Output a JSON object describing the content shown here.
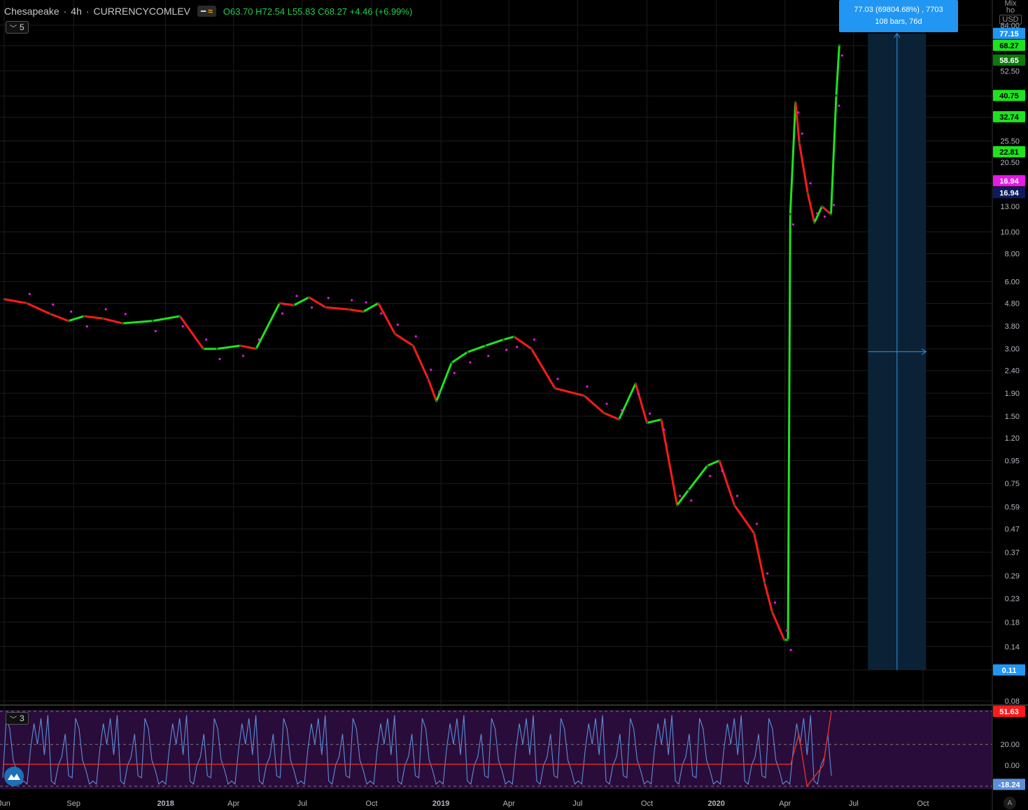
{
  "header": {
    "symbol": "Chesapeake",
    "sep1": "·",
    "interval": "4h",
    "sep2": "·",
    "exchange": "CURRENCYCOMLEV",
    "ohlc": {
      "open_label": "O",
      "open": "63.70",
      "high_label": "H",
      "high": "72.54",
      "low_label": "L",
      "low": "55.83",
      "close_label": "C",
      "close": "68.27",
      "change": "+4.46 (+6.99%)"
    }
  },
  "main_pane_collapse": {
    "label": "5",
    "icon": "chevron-down-icon"
  },
  "indicator_pane_collapse": {
    "label": "3",
    "icon": "chevron-down-icon"
  },
  "measure_tooltip": {
    "line1": "77.03 (69804.68%) , 7703",
    "line2": "108 bars, 76d"
  },
  "currency": {
    "top": "Mix ho",
    "code": "USD"
  },
  "auto_button": "A",
  "colors": {
    "background": "#000000",
    "grid": "#1c1c1c",
    "up": "#1ee31e",
    "down": "#ff1a1a",
    "sar": "#e619e6",
    "oscillator": "#5b8fd9",
    "oscillator_signal": "#e0302a",
    "indicator_bg": "#2a0c3a",
    "measure": "#2196f3",
    "measure_band": "#0b2236"
  },
  "chart_data": [
    {
      "type": "line",
      "title": "",
      "scale": "log",
      "x": [
        "2017-06-01",
        "2017-07-01",
        "2017-08-01",
        "2017-08-25",
        "2017-09-15",
        "2017-10-10",
        "2017-11-05",
        "2017-12-15",
        "2018-01-20",
        "2018-02-20",
        "2018-03-10",
        "2018-04-10",
        "2018-05-01",
        "2018-06-01",
        "2018-06-20",
        "2018-07-10",
        "2018-08-01",
        "2018-09-01",
        "2018-09-20",
        "2018-10-10",
        "2018-11-01",
        "2018-11-25",
        "2018-12-15",
        "2018-12-26",
        "2019-01-15",
        "2019-02-05",
        "2019-03-01",
        "2019-03-25",
        "2019-04-08",
        "2019-05-01",
        "2019-06-01",
        "2019-07-10",
        "2019-08-05",
        "2019-08-25",
        "2019-09-16",
        "2019-10-01",
        "2019-10-20",
        "2019-11-10",
        "2019-11-25",
        "2019-12-20",
        "2020-01-05",
        "2020-01-25",
        "2020-02-20",
        "2020-03-05",
        "2020-03-15",
        "2020-03-31",
        "2020-04-05",
        "2020-04-08",
        "2020-04-15",
        "2020-04-20",
        "2020-05-01",
        "2020-05-10",
        "2020-05-20",
        "2020-06-01",
        "2020-06-08",
        "2020-06-12"
      ],
      "series": [
        {
          "values": [
            5.0,
            4.8,
            4.3,
            4.0,
            4.2,
            4.1,
            3.9,
            4.0,
            4.2,
            3.0,
            3.0,
            3.1,
            3.0,
            4.8,
            4.7,
            5.1,
            4.6,
            4.5,
            4.4,
            4.8,
            3.5,
            3.1,
            2.2,
            1.75,
            2.6,
            2.9,
            3.1,
            3.3,
            3.4,
            3.0,
            2.0,
            1.85,
            1.55,
            1.45,
            2.1,
            1.4,
            1.45,
            0.6,
            0.7,
            0.9,
            0.95,
            0.6,
            0.45,
            0.27,
            0.2,
            0.15,
            0.15,
            12.0,
            38.0,
            25.0,
            15.0,
            11.0,
            13.0,
            12.0,
            40.75,
            68.27
          ]
        }
      ],
      "y_ticks": [
        "84.00",
        "68.00",
        "52.50",
        "40.50",
        "32.50",
        "25.50",
        "20.50",
        "16.50",
        "13.00",
        "10.00",
        "8.00",
        "6.00",
        "4.80",
        "3.80",
        "3.00",
        "2.40",
        "1.90",
        "1.50",
        "1.20",
        "0.95",
        "0.75",
        "0.59",
        "0.47",
        "0.37",
        "0.29",
        "0.23",
        "0.18",
        "0.14",
        "0.11",
        "0.08"
      ],
      "y_tick_values": [
        84,
        68,
        52.5,
        40.5,
        32.5,
        25.5,
        20.5,
        16.5,
        13,
        10,
        8,
        6,
        4.8,
        3.8,
        3,
        2.4,
        1.9,
        1.5,
        1.2,
        0.95,
        0.75,
        0.59,
        0.47,
        0.37,
        0.29,
        0.23,
        0.18,
        0.14,
        0.11,
        0.08
      ],
      "price_badges": [
        {
          "value": 77.15,
          "label": "77.15",
          "color": "#2196f3"
        },
        {
          "value": 68.27,
          "label": "68.27",
          "color": "#1ee31e"
        },
        {
          "value": 58.65,
          "label": "58.65",
          "color": "#0b7a0b"
        },
        {
          "value": 40.75,
          "label": "40.75",
          "color": "#1ee31e"
        },
        {
          "value": 32.74,
          "label": "32.74",
          "color": "#1ee31e"
        },
        {
          "value": 22.81,
          "label": "22.81",
          "color": "#1ee31e"
        },
        {
          "value": 16.94,
          "label": "16.94",
          "color": "#e619e6"
        },
        {
          "value": 16.94,
          "label": "16.94",
          "color": "#0d1b5e"
        },
        {
          "value": 0.11,
          "label": "0.11",
          "color": "#2196f3"
        }
      ],
      "x_ticks": [
        "Jun",
        "Sep",
        "2018",
        "Apr",
        "Jul",
        "Oct",
        "2019",
        "Apr",
        "Jul",
        "Oct",
        "2020",
        "Apr",
        "Jul",
        "Oct"
      ],
      "x_tick_dates": [
        "2017-06-01",
        "2017-09-01",
        "2018-01-01",
        "2018-04-01",
        "2018-07-01",
        "2018-10-01",
        "2019-01-01",
        "2019-04-01",
        "2019-07-01",
        "2019-10-01",
        "2020-01-01",
        "2020-04-01",
        "2020-07-01",
        "2020-10-01"
      ],
      "measure_range": {
        "from": "2020-07-20",
        "to": "2020-10-05",
        "low": 0.11,
        "high": 77.15
      }
    },
    {
      "type": "line",
      "title": "",
      "ylim": [
        -20,
        51.63
      ],
      "y_ticks": [
        "20.00",
        "0.00",
        "-20.00"
      ],
      "y_tick_values": [
        20,
        0,
        -20
      ],
      "price_badges": [
        {
          "value": 51.63,
          "label": "51.63",
          "color": "#ff1a1a"
        },
        {
          "value": -18.24,
          "label": "-18.24",
          "color": "#5b8fd9"
        }
      ],
      "series": [
        {
          "values": [
            -12,
            5,
            -15,
            40,
            10,
            -18,
            30,
            45,
            -5,
            -18,
            20,
            48,
            0,
            -10,
            35,
            -18,
            15,
            45,
            -15,
            8
          ]
        },
        {
          "values": [
            1,
            1,
            1,
            1,
            1,
            1,
            1,
            1,
            1,
            1,
            1,
            1,
            1,
            1,
            1,
            1,
            1,
            1,
            1,
            30,
            -20,
            -10,
            0,
            51.63
          ]
        }
      ]
    }
  ]
}
